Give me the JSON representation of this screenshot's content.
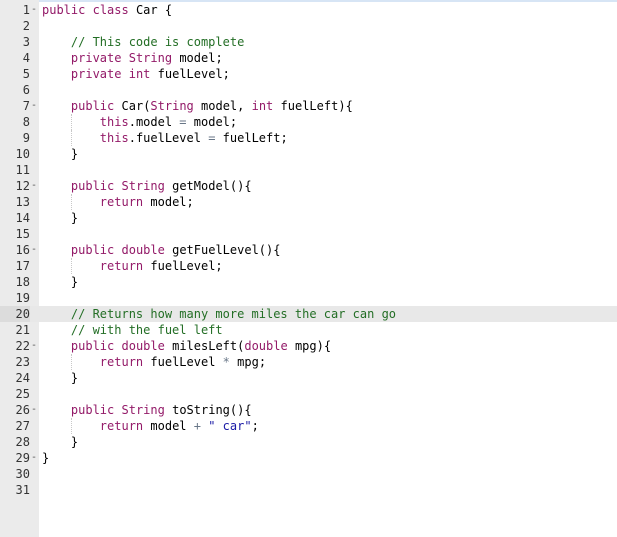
{
  "editor": {
    "active_line": 20,
    "lines": [
      {
        "n": "1",
        "fold": "-",
        "text": "public class Car {"
      },
      {
        "n": "2",
        "fold": "",
        "text": ""
      },
      {
        "n": "3",
        "fold": "",
        "text": "    // This code is complete"
      },
      {
        "n": "4",
        "fold": "",
        "text": "    private String model;"
      },
      {
        "n": "5",
        "fold": "",
        "text": "    private int fuelLevel;"
      },
      {
        "n": "6",
        "fold": "",
        "text": ""
      },
      {
        "n": "7",
        "fold": "-",
        "text": "    public Car(String model, int fuelLeft){"
      },
      {
        "n": "8",
        "fold": "",
        "text": "        this.model = model;"
      },
      {
        "n": "9",
        "fold": "",
        "text": "        this.fuelLevel = fuelLeft;"
      },
      {
        "n": "10",
        "fold": "",
        "text": "    }"
      },
      {
        "n": "11",
        "fold": "",
        "text": ""
      },
      {
        "n": "12",
        "fold": "-",
        "text": "    public String getModel(){"
      },
      {
        "n": "13",
        "fold": "",
        "text": "        return model;"
      },
      {
        "n": "14",
        "fold": "",
        "text": "    }"
      },
      {
        "n": "15",
        "fold": "",
        "text": ""
      },
      {
        "n": "16",
        "fold": "-",
        "text": "    public double getFuelLevel(){"
      },
      {
        "n": "17",
        "fold": "",
        "text": "        return fuelLevel;"
      },
      {
        "n": "18",
        "fold": "",
        "text": "    }"
      },
      {
        "n": "19",
        "fold": "",
        "text": ""
      },
      {
        "n": "20",
        "fold": "",
        "text": "    // Returns how many more miles the car can go"
      },
      {
        "n": "21",
        "fold": "",
        "text": "    // with the fuel left"
      },
      {
        "n": "22",
        "fold": "-",
        "text": "    public double milesLeft(double mpg){"
      },
      {
        "n": "23",
        "fold": "",
        "text": "        return fuelLevel * mpg;"
      },
      {
        "n": "24",
        "fold": "",
        "text": "    }"
      },
      {
        "n": "25",
        "fold": "",
        "text": ""
      },
      {
        "n": "26",
        "fold": "-",
        "text": "    public String toString(){"
      },
      {
        "n": "27",
        "fold": "",
        "text": "        return model + \" car\";"
      },
      {
        "n": "28",
        "fold": "",
        "text": "    }"
      },
      {
        "n": "29",
        "fold": "-",
        "text": "}"
      },
      {
        "n": "30",
        "fold": "",
        "text": ""
      },
      {
        "n": "31",
        "fold": "",
        "text": ""
      }
    ]
  }
}
